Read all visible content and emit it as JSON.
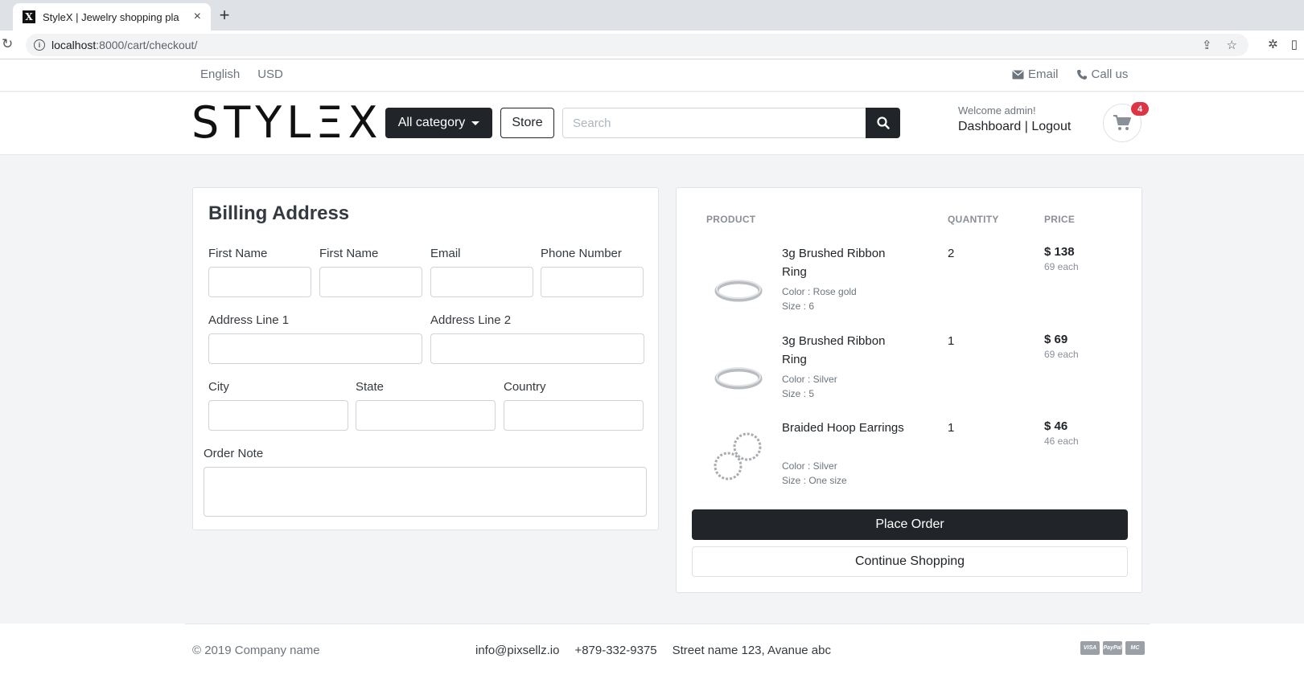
{
  "browser": {
    "tab_title": "StyleX | Jewelry shopping platf",
    "url_host": "localhost",
    "url_rest": ":8000/cart/checkout/"
  },
  "topbar": {
    "language": "English",
    "currency": "USD",
    "email_label": "Email",
    "call_label": "Call us"
  },
  "header": {
    "logo": "STYLΞX",
    "category_button": "All category",
    "store_button": "Store",
    "search_placeholder": "Search",
    "welcome": "Welcome admin!",
    "dashboard_link": "Dashboard",
    "separator": "|",
    "logout_link": "Logout",
    "cart_count": "4"
  },
  "billing": {
    "title": "Billing Address",
    "fields": {
      "first_name": "First Name",
      "last_name": "First Name",
      "email": "Email",
      "phone": "Phone Number",
      "address1": "Address Line 1",
      "address2": "Address Line 2",
      "city": "City",
      "state": "State",
      "country": "Country",
      "order_note": "Order Note"
    }
  },
  "summary": {
    "headers": {
      "product": "PRODUCT",
      "quantity": "QUANTITY",
      "price": "PRICE"
    },
    "items": [
      {
        "name": "3g Brushed Ribbon Ring",
        "color": "Color : Rose gold",
        "size": "Size : 6",
        "qty": "2",
        "price": "$ 138",
        "each": "69 each",
        "icon": "ring-image"
      },
      {
        "name": "3g Brushed Ribbon Ring",
        "color": "Color : Silver",
        "size": "Size : 5",
        "qty": "1",
        "price": "$ 69",
        "each": "69 each",
        "icon": "ring-image"
      },
      {
        "name": "Braided Hoop Earrings",
        "color": "Color : Silver",
        "size": "Size : One size",
        "qty": "1",
        "price": "$ 46",
        "each": "46 each",
        "icon": "earrings-image"
      }
    ],
    "place_order": "Place Order",
    "continue_shopping": "Continue Shopping"
  },
  "footer": {
    "copyright": "© 2019 Company name",
    "email": "info@pixsellz.io",
    "phone": "+879-332-9375",
    "address": "Street name 123, Avanue abc",
    "payments": [
      "VISA",
      "PayPal",
      "MC"
    ]
  }
}
